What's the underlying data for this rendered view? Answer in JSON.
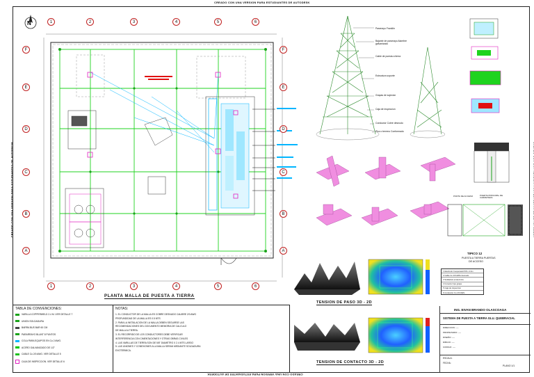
{
  "edu_notice": "CREADO CON UNA VERSION PARA ESTUDIANTES DE AUTODESK",
  "edu_notice_bottom": "CREADO CON UNA VERSION PARA ESTUDIANTES DE AUTODESK",
  "north_label": "N",
  "grid_columns": [
    "1",
    "2",
    "3",
    "4",
    "5",
    "6"
  ],
  "grid_rows": [
    "F",
    "E",
    "D",
    "C",
    "B",
    "A"
  ],
  "plan_title": "PLANTA MALLA DE PUESTA A TIERRA",
  "tower_callouts": [
    "Pararrayo Franklin",
    "Bajante de pararrayo Alambre galvanizado",
    "Cable de puesta a tierra",
    "Estructura soporte",
    "Grapas de sujecion",
    "Caja de inspeccion",
    "Conductor Cobre desnudo",
    "Piso o terreno Conformado"
  ],
  "detail_12": {
    "label": "TIPICO 12",
    "sub1": "PUESTA A TIERRA PUERTAS",
    "sub2": "DE ACCESO",
    "left_tag": "PORTA DE ACCESO",
    "right_tag": "PUERTA PRINCIPAL DE CARRETERA"
  },
  "small_table": [
    "Electrodo Cooperweld 5/8 x 2.4m",
    "Cable Cu 2/0 AWG desnudo",
    "Soldadura exotermica",
    "Conector tipo grapa",
    "Caja de inspeccion",
    "Conductor Cu 2/0 AWG"
  ],
  "step_label": "TENSION DE PASO 3D - 2D",
  "contact_label": "TENSION DE CONTACTO 3D - 2D",
  "legend": {
    "title": "TABLA DE CONVENCIONES:",
    "items": [
      {
        "text": "VARILLA COPPERWELD 2.4 M. VER DETALLE 7",
        "color": "#1aa31a"
      },
      {
        "text": "UNION SOLDADURA",
        "color": "#1aa31a"
      },
      {
        "text": "BARRA BUS BAR 60 CM",
        "color": "#444444"
      },
      {
        "text": "PARARRAYO BLUNT 8 PUNTOS",
        "color": "#1aa31a"
      },
      {
        "text": "COLA PARA EQUIPOS EN Cu 2 AWG.",
        "color": "#00b5ff"
      },
      {
        "text": "ACERO GALVANIZADO DE 1/2\"",
        "color": "#00c800"
      },
      {
        "text": "CABLE Cu 2/0 AWG. VER DETALLE 5",
        "color": "#20c020"
      },
      {
        "text": "CAJA DE INSPECCION. VER DETALLE 6",
        "color": "#e020c0"
      }
    ]
  },
  "notes": {
    "title": "NOTAS:",
    "items": [
      "1.    EL CONDUCTOR DE LA MALLA ES COBRE DESNUDO CALIBRE 2/0 AWG",
      "        PROFUNDIDAD DE LA MALLA ES 0.5 MTS",
      "2.    PARA LA INSTALACION DE LA MALLA DEBEN SEGUIRSE LAS",
      "        RECOMENDACIONES DEL DOCUMENTO MEMORIA DE CALCULO",
      "        DE MALLA A TIERRA.",
      "3.    EL RECORRIDO DE LOS CONDUCTORES DEBE VERIFICAR",
      "        INTERFERENCIA CON CIMENTACIONES Y OTRAS OBRAS CIVILES",
      "4.    LAS VARILLAS DE TIERRA SON DE 5/8\" DIAMETRO X 2.4 MTS LARGO",
      "5.    LAS UNIONES Y CONEXIONES A LA MALLA SERAN MEDIANTE SOLDADURA",
      "        EXOTERMICA."
    ]
  },
  "title_block": {
    "engineer": "ING. EIVAN BRANDO OLASCOAGA",
    "project": "SISTEMA DE PUESTA A TIERRA GLU. QUEBRACIAL",
    "rows": [
      "DIRECCION: ----",
      "PROPIETARIO: ----",
      "DISEÑO: ----",
      "DIBUJO: ----",
      "CODIGO: ----"
    ],
    "scale_label": "ESCALA:",
    "date_label": "FECHA:",
    "sheet_label": "PLANO 1/1"
  },
  "colors": {
    "mesh": "#1fd31f",
    "cable": "#00b5ff",
    "inspection": "#e020c0",
    "red_note": "#e01010"
  }
}
